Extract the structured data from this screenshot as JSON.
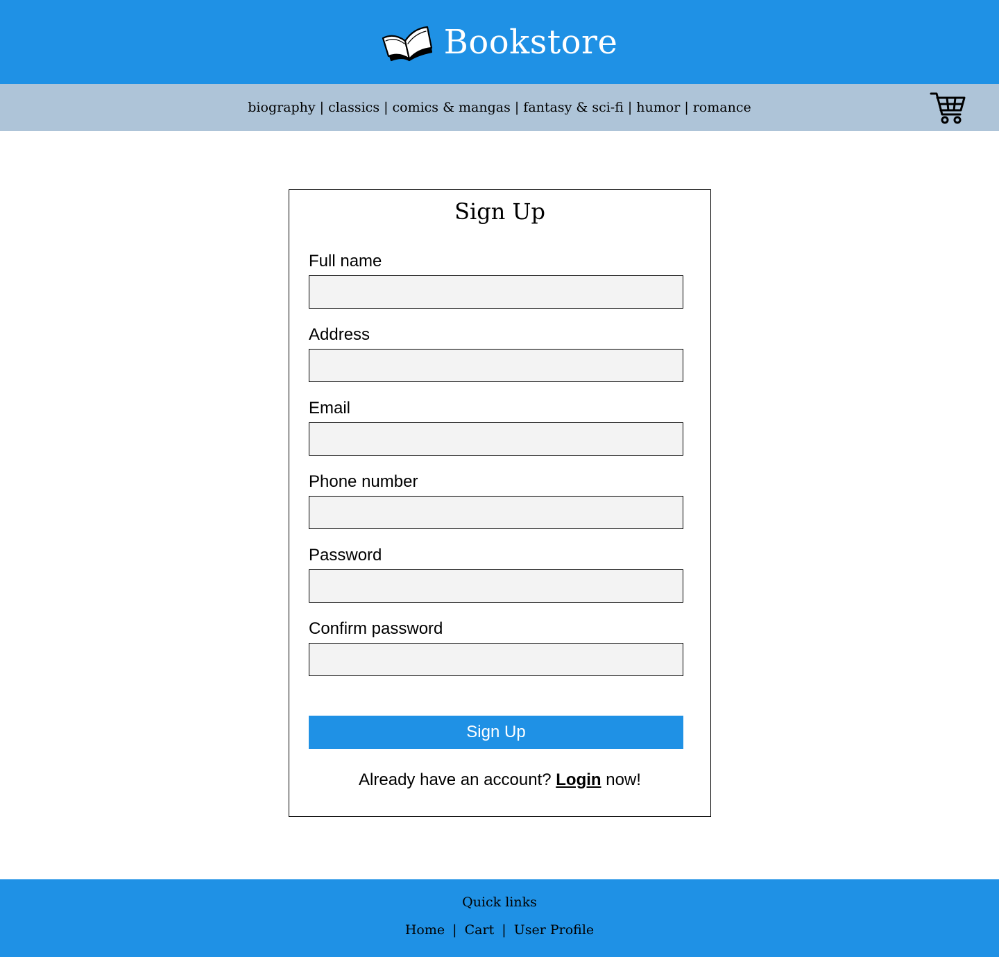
{
  "header": {
    "brand_title": "Bookstore",
    "brand_icon": "open-book-icon"
  },
  "nav": {
    "categories": [
      "biography",
      "classics",
      "comics & mangas",
      "fantasy & sci-fi",
      "humor",
      "romance"
    ],
    "separator": "|",
    "cart_icon": "shopping-cart-icon"
  },
  "form": {
    "title": "Sign Up",
    "fields": [
      {
        "label": "Full name",
        "value": ""
      },
      {
        "label": "Address",
        "value": ""
      },
      {
        "label": "Email",
        "value": ""
      },
      {
        "label": "Phone number",
        "value": ""
      },
      {
        "label": "Password",
        "value": ""
      },
      {
        "label": "Confirm password",
        "value": ""
      }
    ],
    "submit_label": "Sign Up",
    "login_prompt_before": "Already have an account?",
    "login_link": "Login",
    "login_prompt_after": "now!"
  },
  "footer": {
    "title": "Quick links",
    "links": [
      "Home",
      "Cart",
      "User Profile"
    ],
    "separator": "|"
  },
  "colors": {
    "header_bg": "#1f91e5",
    "nav_bg": "#aec4d8",
    "input_bg": "#f3f3f3",
    "button_bg": "#1f91e5",
    "footer_bg": "#1f91e5"
  }
}
